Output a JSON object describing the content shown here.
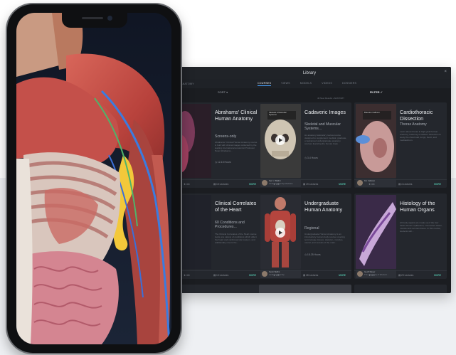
{
  "library": {
    "title": "Library",
    "close_glyph": "×",
    "nav_left": "ANATOMY",
    "tabs": [
      "COURSES",
      "VIEWS",
      "MODELS",
      "VIDEOS",
      "DOSSIERS"
    ],
    "sort_label": "SORT ▾",
    "filter_label": "FILTER ✓",
    "subtitle": "46 New Results • ANATOMY"
  },
  "cards": [
    {
      "title": "Abrahams' Clinical Human Anatomy",
      "subtitle": "Screens-only",
      "description": "Abrahams' Clinical Human Anatomy course is built with clinical images collected by the leading international anatomist Professor Peter Abrahams...",
      "hours": "12-15 Hours",
      "rating": "4.6",
      "lectures": "15 Lectures",
      "more": "MORE",
      "thumb_label": "",
      "author": "",
      "institution": ""
    },
    {
      "title": "Cadaveric Images",
      "subtitle": "Skeletal and Muscular Systems...",
      "description": "An anatomy laboratory review course designed to supplement medical, graduate, or advanced undergraduate anatomy courses featuring the human body.",
      "hours": "3-4 Hours",
      "rating": "4.6",
      "lectures": "19 Lectures",
      "more": "MORE",
      "thumb_label": "Skeletal & Muscular Systems",
      "author": "Kerr J. Bellini",
      "institution": "Lander University Medicine"
    },
    {
      "title": "Cardiothoracic Dissection",
      "subtitle": "Thorax Anatomy",
      "description": "Learn about thorax in high-yield format anatomy, featuring a cadaver dissection to study the chest wall, lungs, heart, and mediastinum.",
      "hours": "",
      "rating": "4.6",
      "lectures": "4 Lectures",
      "more": "MORE",
      "thumb_label": "Brandon Calhoun",
      "author": "Kin Calhoun",
      "institution": ""
    },
    {
      "title": "Clinical Correlates of the Heart",
      "subtitle": "60 Conditions and Procedures...",
      "description": "The Clinical Correlates of the Heart course looks at a variety of conditions which affect the heart and cardiovascular system, and additionally covers the...",
      "hours": "",
      "rating": "4.8",
      "lectures": "13 Lectures",
      "more": "MORE",
      "thumb_label": "",
      "author": "",
      "institution": ""
    },
    {
      "title": "Undergraduate Human Anatomy",
      "subtitle": "Regional",
      "description": "Undergraduate Human Anatomy is an introductory human body course covering terminology, tissues, skeleton, muscles, neural, and vessels of the main...",
      "hours": "18-25 Hours",
      "rating": "4.5",
      "lectures": "28 Lectures",
      "more": "MORE",
      "thumb_label": "",
      "author": "Kevin Bellini",
      "institution": "Lander University"
    },
    {
      "title": "Histology of the Human Organs",
      "subtitle": "",
      "description": "All body organs are made up of the four basic tissues: epithelium, connective tissue, muscle and nervous tissue. In this course, students will...",
      "hours": "",
      "rating": "4.3",
      "lectures": "23 Lectures",
      "more": "MORE",
      "thumb_label": "",
      "author": "Geoff Meyer",
      "institution": "The University of Western..."
    }
  ],
  "colors": {
    "window_bg": "#1b1d21",
    "card_bg": "#24272d",
    "accent_more": "#4fb6a0",
    "tab_underline": "#4aa3ff"
  },
  "icons": [
    "close-icon",
    "play-icon",
    "star-icon",
    "lectures-icon",
    "clock-icon",
    "checkmark-icon"
  ]
}
